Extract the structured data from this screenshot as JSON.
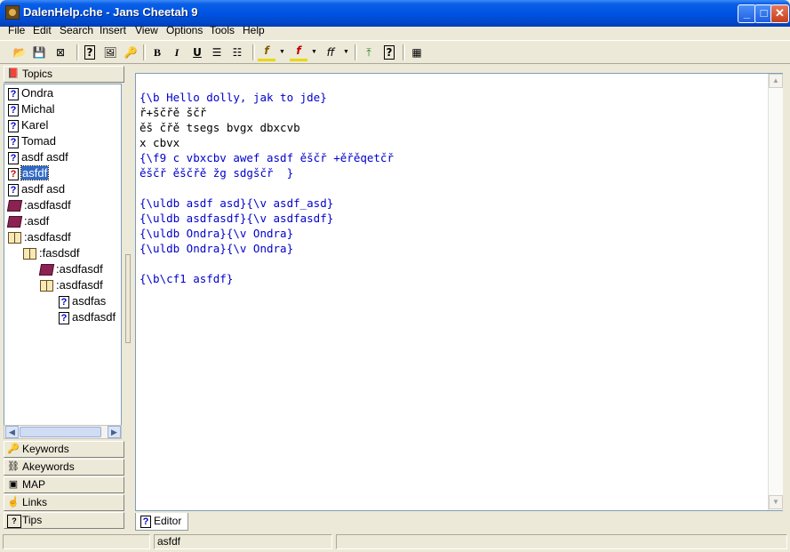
{
  "window": {
    "title": "DalenHelp.che - Jans Cheetah 9"
  },
  "menu": [
    "File",
    "Edit",
    "Search",
    "Insert",
    "View",
    "Options",
    "Tools",
    "Help"
  ],
  "toolbar": {
    "bold": "B",
    "italic": "I",
    "underline": "U",
    "font_color_glyph": "f",
    "font_size_glyph": "ff"
  },
  "left_panel": {
    "topics_tab": "Topics",
    "tabs": [
      "Keywords",
      "Akeywords",
      "MAP",
      "Links",
      "Tips"
    ]
  },
  "tree": [
    {
      "label": "Ondra",
      "icon": "question-icon",
      "indent": 0
    },
    {
      "label": "Michal",
      "icon": "question-icon",
      "indent": 0
    },
    {
      "label": "Karel",
      "icon": "question-icon",
      "indent": 0
    },
    {
      "label": "Tomad",
      "icon": "question-icon",
      "indent": 0
    },
    {
      "label": "asdf asdf",
      "icon": "question-icon",
      "indent": 0
    },
    {
      "label": "asfdf",
      "icon": "question-red-icon",
      "indent": 0,
      "selected": true
    },
    {
      "label": "asdf asd",
      "icon": "question-icon",
      "indent": 0
    },
    {
      "label": ":asdfasdf",
      "icon": "book-closed-icon",
      "indent": 0
    },
    {
      "label": ":asdf",
      "icon": "book-closed-icon",
      "indent": 0
    },
    {
      "label": ":asdfasdf",
      "icon": "book-open-icon",
      "indent": 0
    },
    {
      "label": ":fasdsdf",
      "icon": "book-open-icon",
      "indent": 1
    },
    {
      "label": ":asdfasdf",
      "icon": "book-closed-icon",
      "indent": 2
    },
    {
      "label": ":asdfasdf",
      "icon": "book-open-icon",
      "indent": 2
    },
    {
      "label": "asdfas",
      "icon": "question-icon",
      "indent": 3
    },
    {
      "label": "asdfasdf",
      "icon": "question-icon",
      "indent": 3
    }
  ],
  "editor": {
    "lines": [
      {
        "text": "{\\b Hello dolly, jak to jde}",
        "color": "blue"
      },
      {
        "text": "ř+ščřě ščř",
        "color": "black"
      },
      {
        "text": "ěš čřě tsegs bvgx dbxcvb",
        "color": "black"
      },
      {
        "text": "x cbvx",
        "color": "black"
      },
      {
        "text": "{\\f9 c vbxcbv awef asdf ěščř +ěřěqetčř",
        "color": "blue"
      },
      {
        "text": "ěščř ěščřě žg sdgščř  }",
        "color": "blue"
      },
      {
        "text": "",
        "color": "black"
      },
      {
        "text": "{\\uldb asdf asd}{\\v asdf_asd}",
        "color": "blue"
      },
      {
        "text": "{\\uldb asdfasdf}{\\v asdfasdf}",
        "color": "blue"
      },
      {
        "text": "{\\uldb Ondra}{\\v Ondra}",
        "color": "blue"
      },
      {
        "text": "{\\uldb Ondra}{\\v Ondra}",
        "color": "blue"
      },
      {
        "text": "",
        "color": "black"
      },
      {
        "text": "{\\b\\cf1 asfdf}",
        "color": "blue"
      }
    ],
    "tab_label": "Editor"
  },
  "status": {
    "panel1": "",
    "panel2": "asfdf",
    "panel3": ""
  },
  "colors": {
    "code_blue": "#0000cc",
    "selection": "#316ac5",
    "title_bar": "#0054e3"
  }
}
